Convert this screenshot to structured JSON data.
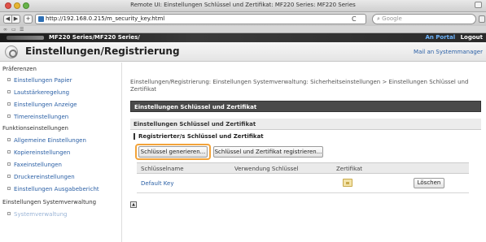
{
  "window": {
    "title": "Remote UI: Einstellungen Schlüssel und Zertifikat: MF220 Series: MF220 Series"
  },
  "browser": {
    "url": "http://192.168.0.215/m_security_key.html",
    "search_placeholder": "Google",
    "reload_glyph": "C"
  },
  "header": {
    "product": "MF220 Series/MF220 Series/",
    "portal": "An Portal",
    "logout": "Logout"
  },
  "title_bar": {
    "title": "Einstellungen/Registrierung",
    "mail_admin": "Mail an Systemmanager"
  },
  "sidebar": {
    "groups": [
      {
        "label": "Präferenzen",
        "items": [
          "Einstellungen Papier",
          "Lautstärkeregelung",
          "Einstellungen Anzeige",
          "Timereinstellungen"
        ]
      },
      {
        "label": "Funktionseinstellungen",
        "items": [
          "Allgemeine Einstellungen",
          "Kopiereinstellungen",
          "Faxeinstellungen",
          "Druckereinstellungen",
          "Einstellungen Ausgabebericht"
        ]
      },
      {
        "label": "Einstellungen Systemverwaltung",
        "items": [
          "Systemverwaltung"
        ]
      }
    ]
  },
  "main": {
    "breadcrumb": "Einstellungen/Registrierung: Einstellungen Systemverwaltung: Sicherheitseinstellungen > Einstellungen Schlüssel und Zertifikat",
    "section_title": "Einstellungen Schlüssel und Zertifikat",
    "sub_title": "Einstellungen Schlüssel und Zertifikat",
    "registered_heading": "Registrierter/s Schlüssel und Zertifikat",
    "generate_button": "Schlüssel generieren...",
    "register_button": "Schlüssel und Zertifikat registrieren...",
    "table": {
      "headers": [
        "Schlüsselname",
        "Verwendung Schlüssel",
        "Zertifikat"
      ],
      "rows": [
        {
          "name": "Default Key",
          "usage": "",
          "delete_label": "Löschen"
        }
      ]
    }
  }
}
